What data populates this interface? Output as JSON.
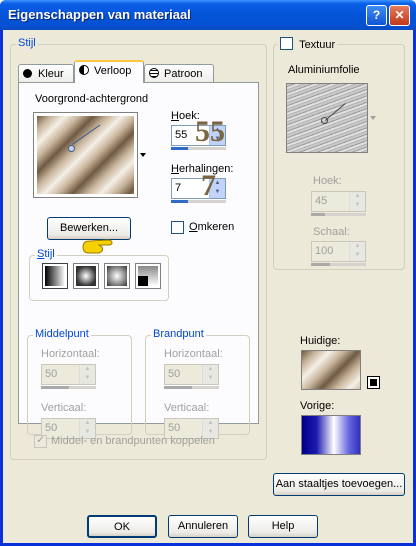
{
  "window": {
    "title": "Eigenschappen van materiaal",
    "help_glyph": "?",
    "close_glyph": "✕"
  },
  "stijl_group": {
    "legend": "Stijl",
    "tabs": [
      {
        "label": "Kleur",
        "icon": "filled-circle-icon"
      },
      {
        "label": "Verloop",
        "icon": "half-circle-icon"
      },
      {
        "label": "Patroon",
        "icon": "pattern-icon"
      }
    ],
    "active_tab": "Verloop"
  },
  "gradient": {
    "name": "Voorgrond-achtergrond",
    "hoek_label": "Hoek:",
    "hoek_value": "55",
    "herhalingen_label": "Herhalingen:",
    "herhalingen_value": "7",
    "bewerken_label": "Bewerken...",
    "omkeren_label": "Omkeren",
    "omkeren_checked": false,
    "annotation_hoek": "55",
    "annotation_herhalingen": "7",
    "stijl_legend": "Stijl",
    "styles": [
      "linear",
      "rectangular",
      "radial",
      "sunburst"
    ]
  },
  "middelpunt": {
    "legend": "Middelpunt",
    "horizontaal_label": "Horizontaal:",
    "horizontaal_value": "50",
    "verticaal_label": "Verticaal:",
    "verticaal_value": "50"
  },
  "brandpunt": {
    "legend": "Brandpunt",
    "horizontaal_label": "Horizontaal:",
    "horizontaal_value": "50",
    "verticaal_label": "Verticaal:",
    "verticaal_value": "50"
  },
  "koppelen": {
    "label": "Middel- en brandpunten koppelen",
    "checked": true
  },
  "textuur": {
    "label": "Textuur",
    "checked": false,
    "name": "Aluminiumfolie",
    "hoek_label": "Hoek:",
    "hoek_value": "45",
    "schaal_label": "Schaal:",
    "schaal_value": "100"
  },
  "preview": {
    "huidige_label": "Huidige:",
    "vorige_label": "Vorige:"
  },
  "staaltjes_button": "Aan staaltjes toevoegen...",
  "footer": {
    "ok": "OK",
    "annuleren": "Annuleren",
    "help": "Help"
  },
  "colors": {
    "title_bar": "#0454d8",
    "dialog_bg": "#ece9d8",
    "legend_blue": "#0046d5",
    "gradient_dark": "#6e5a42",
    "gradient_light": "#f5efe6",
    "vorige_blue": "#0000a0"
  }
}
